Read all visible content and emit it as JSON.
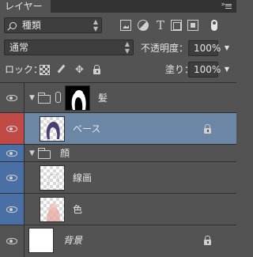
{
  "panel": {
    "tab_label": "レイヤー",
    "menu_icon": "panel-menu-icon"
  },
  "filter": {
    "kind_label": "種類",
    "icons": [
      "image-filter-icon",
      "adjustment-filter-icon",
      "type-filter-icon",
      "shape-filter-icon",
      "smart-object-filter-icon"
    ],
    "toggle_icon": "filter-toggle-icon"
  },
  "blend": {
    "mode": "通常",
    "opacity_label": "不透明度：",
    "opacity_value": "100%"
  },
  "lock": {
    "label": "ロック：",
    "icons": [
      "lock-transparent-pixels-icon",
      "lock-image-pixels-icon",
      "lock-position-icon",
      "lock-all-icon"
    ],
    "fill_label": "塗り：",
    "fill_value": "100%"
  },
  "layers": [
    {
      "name": "髪",
      "type": "group-with-mask",
      "expanded": true,
      "visible": true,
      "selected": false
    },
    {
      "name": "ベース",
      "type": "pixel",
      "visible": true,
      "selected": true,
      "locked": true,
      "eye_color": "#c24a46"
    },
    {
      "name": "顔",
      "type": "group",
      "expanded": true,
      "visible": true,
      "selected": false,
      "eye_color": "#4a6fa5"
    },
    {
      "name": "線画",
      "type": "pixel",
      "visible": true,
      "selected": false,
      "eye_color": "#4a6fa5"
    },
    {
      "name": "色",
      "type": "pixel",
      "visible": true,
      "selected": false,
      "eye_color": "#4a6fa5"
    },
    {
      "name": "背景",
      "type": "background",
      "visible": true,
      "selected": false,
      "locked": true
    }
  ],
  "colors": {
    "panel_bg": "#535353",
    "selected_row": "#6c87a6",
    "red_tag": "#c24a46",
    "blue_tag": "#4a6fa5"
  }
}
